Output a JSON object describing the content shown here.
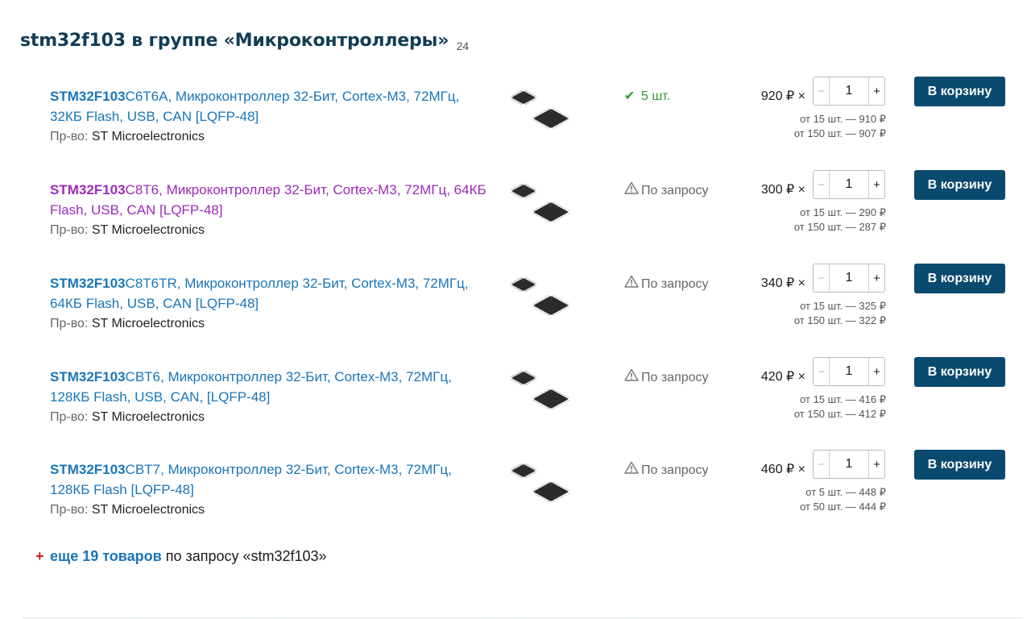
{
  "group": {
    "title": "stm32f103 в группе «Микроконтроллеры»",
    "count": "24"
  },
  "products": [
    {
      "name_bold": "STM32F103",
      "name_rest": "C6T6A, Микроконтроллер 32-Бит, Cortex-M3, 72МГц, 32КБ Flash, USB, CAN [LQFP-48]",
      "maker_label": "Пр-во:",
      "maker": "ST Microelectronics",
      "stock_icon": "check-icon",
      "stock": "5 шт.",
      "price": "920 ₽ ×",
      "qty": "1",
      "minus": "−",
      "plus": "+",
      "tier1": "от 15 шт. — 910 ₽",
      "tier2": "от 150 шт. — 907 ₽",
      "button": "В корзину"
    },
    {
      "name_bold": "STM32F103",
      "name_rest": "C8T6, Микроконтроллер 32-Бит, Cortex-M3, 72МГц, 64КБ Flash, USB, CAN [LQFP-48]",
      "maker_label": "Пр-во:",
      "maker": "ST Microelectronics",
      "stock_icon": "warning-icon",
      "stock": "По запросу",
      "price": "300 ₽ ×",
      "qty": "1",
      "minus": "−",
      "plus": "+",
      "tier1": "от 15 шт. — 290 ₽",
      "tier2": "от 150 шт. — 287 ₽",
      "button": "В корзину"
    },
    {
      "name_bold": "STM32F103",
      "name_rest": "C8T6TR, Микроконтроллер 32-Бит, Cortex-M3, 72МГц, 64КБ Flash, USB, CAN [LQFP-48]",
      "maker_label": "Пр-во:",
      "maker": "ST Microelectronics",
      "stock_icon": "warning-icon",
      "stock": "По запросу",
      "price": "340 ₽ ×",
      "qty": "1",
      "minus": "−",
      "plus": "+",
      "tier1": "от 15 шт. — 325 ₽",
      "tier2": "от 150 шт. — 322 ₽",
      "button": "В корзину"
    },
    {
      "name_bold": "STM32F103",
      "name_rest": "CBT6, Микроконтроллер 32-Бит, Cortex-M3, 72МГц, 128КБ Flash, USB, CAN, [LQFP-48]",
      "maker_label": "Пр-во:",
      "maker": "ST Microelectronics",
      "stock_icon": "warning-icon",
      "stock": "По запросу",
      "price": "420 ₽ ×",
      "qty": "1",
      "minus": "−",
      "plus": "+",
      "tier1": "от 15 шт. — 416 ₽",
      "tier2": "от 150 шт. — 412 ₽",
      "button": "В корзину"
    },
    {
      "name_bold": "STM32F103",
      "name_rest": "CBT7, Микроконтроллер 32-Бит, Cortex-M3, 72МГц, 128КБ Flash [LQFP-48]",
      "maker_label": "Пр-во:",
      "maker": "ST Microelectronics",
      "stock_icon": "warning-icon",
      "stock": "По запросу",
      "price": "460 ₽ ×",
      "qty": "1",
      "minus": "−",
      "plus": "+",
      "tier1": "от 5 шт. — 448 ₽",
      "tier2": "от 50 шт. — 444 ₽",
      "button": "В корзину"
    }
  ],
  "more": {
    "icon": "plus-icon",
    "link": "еще 19 товаров",
    "rest": " по запросу «stm32f103»"
  },
  "colors": {
    "link": "#1a75b8",
    "visited_link": "#9c2ab8",
    "button": "#0a4a6e",
    "in_stock": "#2a9d2a",
    "title": "#123c56"
  }
}
